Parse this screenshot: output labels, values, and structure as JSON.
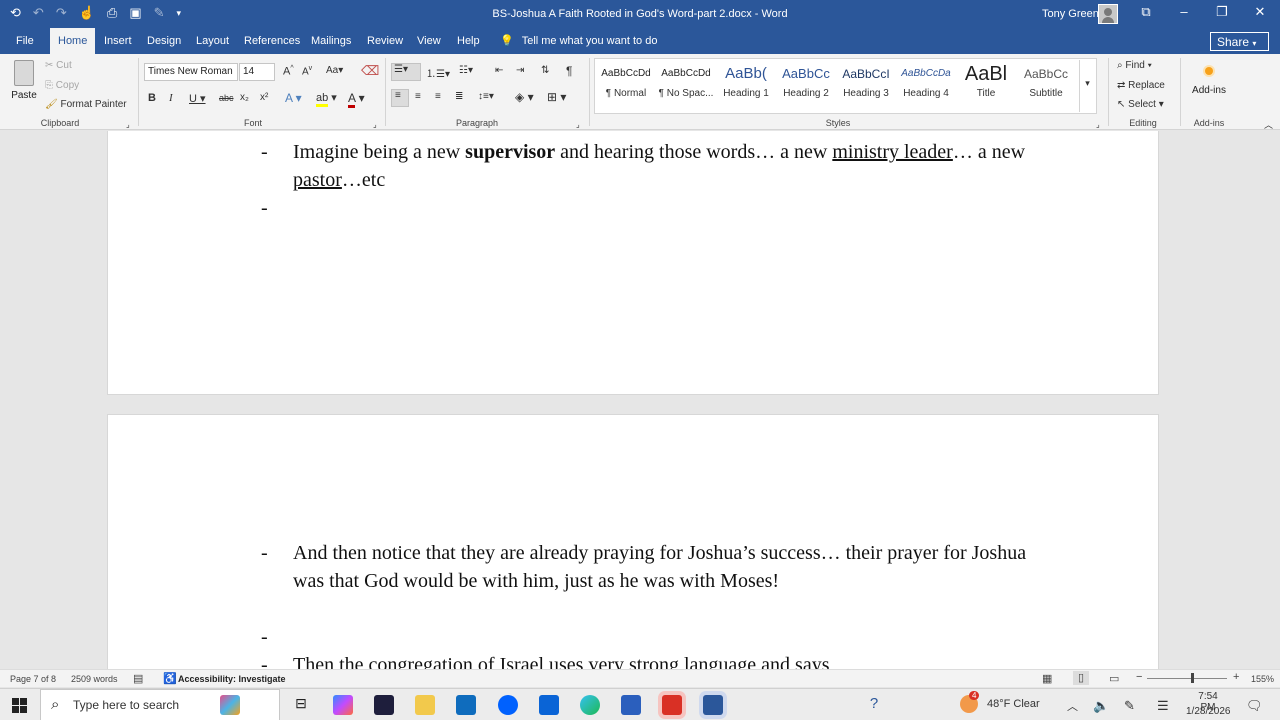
{
  "window": {
    "title": "BS-Joshua A Faith Rooted in God's Word-part 2.docx  -  Word",
    "user": "Tony Greene"
  },
  "tabs": [
    "File",
    "Home",
    "Insert",
    "Design",
    "Layout",
    "References",
    "Mailings",
    "Review",
    "View",
    "Help"
  ],
  "active_tab": "Home",
  "tell_me": "Tell me what you want to do",
  "share_label": "Share",
  "ribbon": {
    "clipboard": {
      "paste": "Paste",
      "cut": "Cut",
      "copy": "Copy",
      "format_painter": "Format Painter",
      "label": "Clipboard"
    },
    "font": {
      "name": "Times New Roman",
      "size": "14",
      "label": "Font"
    },
    "paragraph": {
      "label": "Paragraph"
    },
    "styles": {
      "label": "Styles",
      "items": [
        {
          "sample": "AaBbCcDd",
          "name": "¶ Normal"
        },
        {
          "sample": "AaBbCcDd",
          "name": "¶ No Spac..."
        },
        {
          "sample": "AaBb(",
          "name": "Heading 1"
        },
        {
          "sample": "AaBbCc",
          "name": "Heading 2"
        },
        {
          "sample": "AaBbCcI",
          "name": "Heading 3"
        },
        {
          "sample": "AaBbCcDa",
          "name": "Heading 4"
        },
        {
          "sample": "AaBl",
          "name": "Title"
        },
        {
          "sample": "AaBbCc",
          "name": "Subtitle"
        }
      ]
    },
    "editing": {
      "find": "Find",
      "replace": "Replace",
      "select": "Select",
      "label": "Editing"
    },
    "addins": {
      "button": "Add-ins",
      "label": "Add-ins"
    }
  },
  "document": {
    "page1": {
      "p1_prefix": "Imagine being a new ",
      "p1_bold": "supervisor",
      "p1_mid": " and hearing those words… a new ",
      "p1_u1": "ministry leader",
      "p1_mid2": "… a new ",
      "p1_u2": "pastor",
      "p1_suffix": "…etc",
      "bullet": "-"
    },
    "page2": {
      "p2": "And then notice that they are already praying for Joshua’s success… their prayer for Joshua was that God would be with him, just as he was with Moses!",
      "p3": "Then the congregation of Israel uses very strong language and says",
      "bullet": "-"
    }
  },
  "status": {
    "page": "Page 7 of 8",
    "words": "2509 words",
    "accessibility": "Accessibility: Investigate",
    "zoom": "155%"
  },
  "taskbar": {
    "search_placeholder": "Type here to search",
    "weather": "48°F  Clear",
    "weather_badge": "4",
    "time": "7:54 PM",
    "date": "1/28/2026"
  }
}
